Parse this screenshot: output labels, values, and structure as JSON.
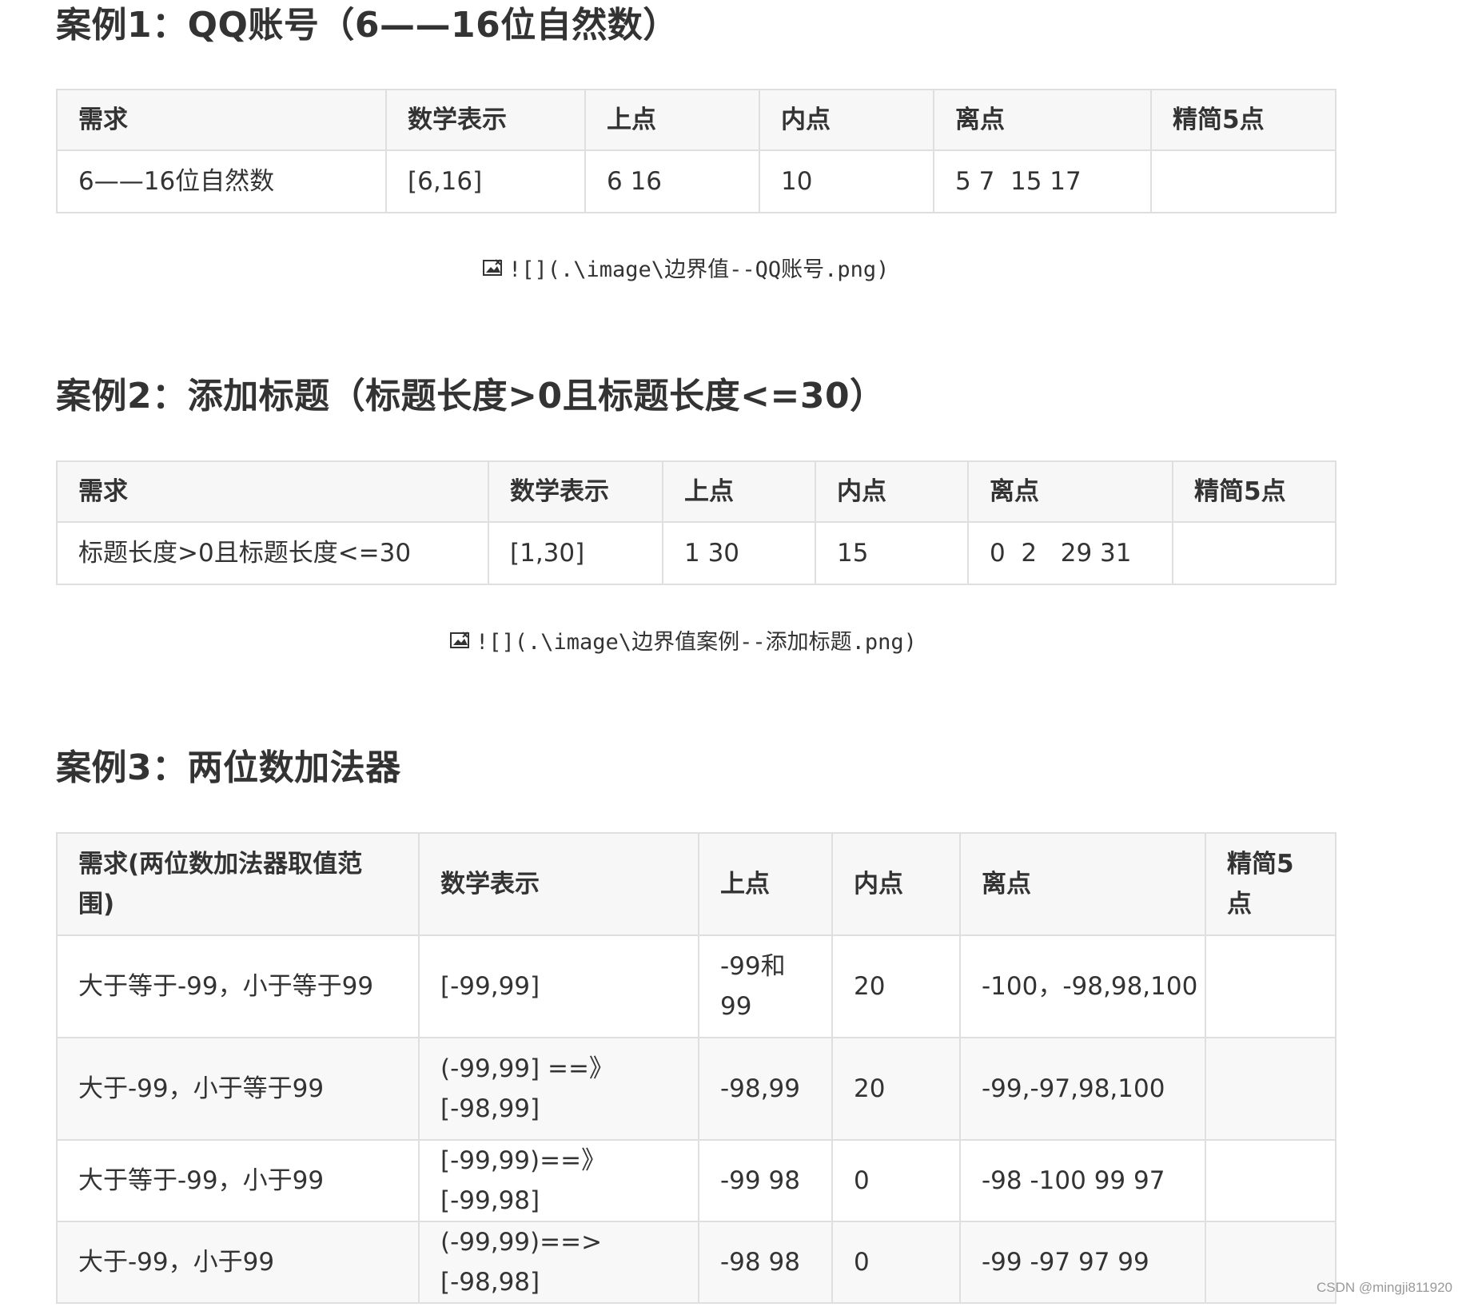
{
  "sections": [
    {
      "title": "案例1：QQ账号（6——16位自然数）",
      "headers": [
        "需求",
        "数学表示",
        "上点",
        "内点",
        "离点",
        "精简5点"
      ],
      "rows": [
        [
          "6——16位自然数",
          "[6,16]",
          "6 16",
          "10",
          "5 7  15 17",
          ""
        ]
      ],
      "caption": "![](.\\image\\边界值--QQ账号.png)"
    },
    {
      "title": "案例2：添加标题（标题长度>0且标题长度<=30）",
      "headers": [
        "需求",
        "数学表示",
        "上点",
        "内点",
        "离点",
        "精简5点"
      ],
      "rows": [
        [
          "标题长度>0且标题长度<=30",
          "[1,30]",
          "1 30",
          "15",
          "0  2   29 31",
          ""
        ]
      ],
      "caption": "![](.\\image\\边界值案例--添加标题.png)"
    },
    {
      "title": "案例3：两位数加法器",
      "headers": [
        "需求(两位数加法器取值范围)",
        "数学表示",
        "上点",
        "内点",
        "离点",
        "精简5点"
      ],
      "rows": [
        [
          "大于等于-99，小于等于99",
          "[-99,99]",
          "-99和99",
          "20",
          "-100，-98,98,100",
          ""
        ],
        [
          "大于-99，小于等于99",
          "(-99,99] ==》[-98,99]",
          "-98,99",
          "20",
          "-99,-97,98,100",
          ""
        ],
        [
          "大于等于-99，小于99",
          "[-99,99)==》[-99,98]",
          "-99 98",
          "0",
          "-98 -100 99 97",
          ""
        ],
        [
          "大于-99，小于99",
          "(-99,99)==>[-98,98]",
          "-98 98",
          "0",
          "-99 -97 97 99",
          ""
        ]
      ]
    }
  ],
  "watermark": "CSDN @mingji811920",
  "icons": {
    "caption_icon": "broken-image-icon"
  }
}
